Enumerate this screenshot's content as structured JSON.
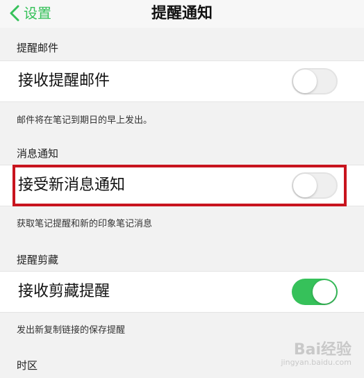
{
  "nav": {
    "back_label": "设置",
    "title": "提醒通知"
  },
  "sections": {
    "reminder_email": {
      "header": "提醒邮件",
      "row_label": "接收提醒邮件",
      "toggle_on": false,
      "footnote": "邮件将在笔记到期日的早上发出。"
    },
    "message_notice": {
      "header": "消息通知",
      "row_label": "接受新消息通知",
      "toggle_on": false,
      "footnote": "获取笔记提醒和新的印象笔记消息"
    },
    "clip_reminder": {
      "header": "提醒剪藏",
      "row_label": "接收剪藏提醒",
      "toggle_on": true,
      "footnote": "发出新复制链接的保存提醒"
    },
    "timezone": {
      "header": "时区"
    }
  },
  "watermark": {
    "main": "Bai经验",
    "sub": "jingyan.baidu.com"
  },
  "colors": {
    "accent": "#36c15a",
    "highlight": "#c8141e"
  }
}
